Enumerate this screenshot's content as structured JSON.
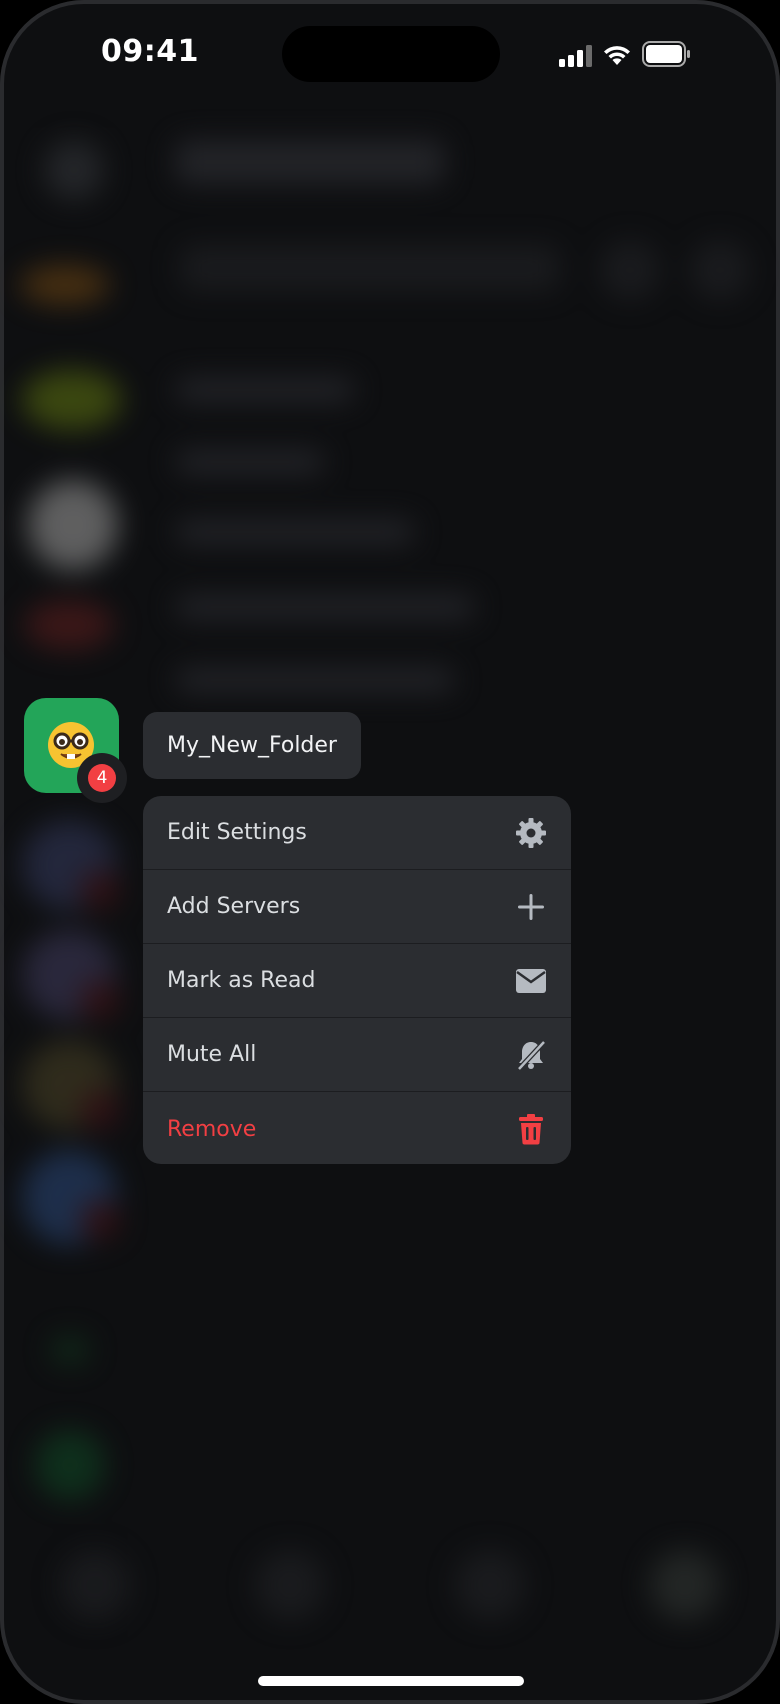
{
  "status_bar": {
    "time": "09:41",
    "icons": [
      "cellular-signal-icon",
      "wifi-icon",
      "battery-icon"
    ]
  },
  "folder": {
    "emoji_icon": "nerd-face-emoji",
    "color": "#23a559",
    "badge_count": "4",
    "name": "My_New_Folder"
  },
  "menu": {
    "items": [
      {
        "label": "Edit Settings",
        "icon": "gear-icon"
      },
      {
        "label": "Add Servers",
        "icon": "plus-icon"
      },
      {
        "label": "Mark as Read",
        "icon": "envelope-icon"
      },
      {
        "label": "Mute All",
        "icon": "bell-slash-icon"
      },
      {
        "label": "Remove",
        "icon": "trash-icon",
        "destructive": true
      }
    ]
  },
  "colors": {
    "danger": "#f23f43",
    "menu_bg": "#2b2d31",
    "text": "#dbdee1"
  }
}
